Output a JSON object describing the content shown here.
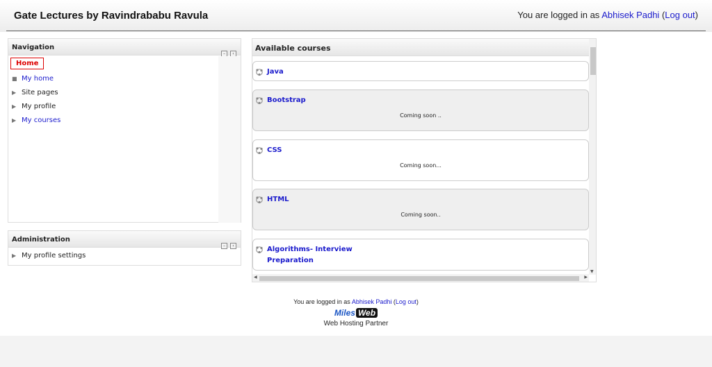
{
  "header": {
    "site_title": "Gate Lectures by Ravindrababu Ravula",
    "login_prefix": "You are logged in as ",
    "user_name": "Abhisek Padhi",
    "logout_label": "Log out"
  },
  "navigation": {
    "title": "Navigation",
    "home_label": "Home",
    "items": [
      {
        "label": "My home",
        "marker": "square",
        "link": true
      },
      {
        "label": "Site pages",
        "marker": "triangle",
        "link": false
      },
      {
        "label": "My profile",
        "marker": "triangle",
        "link": false
      },
      {
        "label": "My courses",
        "marker": "triangle",
        "link": true
      }
    ]
  },
  "administration": {
    "title": "Administration",
    "items": [
      {
        "label": "My profile settings"
      }
    ]
  },
  "courses": {
    "title": "Available courses",
    "list": [
      {
        "name": "Java",
        "summary": ""
      },
      {
        "name": "Bootstrap",
        "summary": "Coming soon .."
      },
      {
        "name": "CSS",
        "summary": "Coming soon..."
      },
      {
        "name": "HTML",
        "summary": "Coming soon.."
      },
      {
        "name": "Algorithms- Interview Preparation",
        "summary": ""
      }
    ]
  },
  "footer": {
    "login_prefix": "You are logged in as ",
    "user_name": "Abhisek Padhi",
    "logout_label": "Log out",
    "logo_miles": "Miles",
    "logo_web": "Web",
    "partner_text": "Web Hosting Partner"
  },
  "colors": {
    "link": "#1a1acc",
    "home_highlight": "#dd0000"
  }
}
